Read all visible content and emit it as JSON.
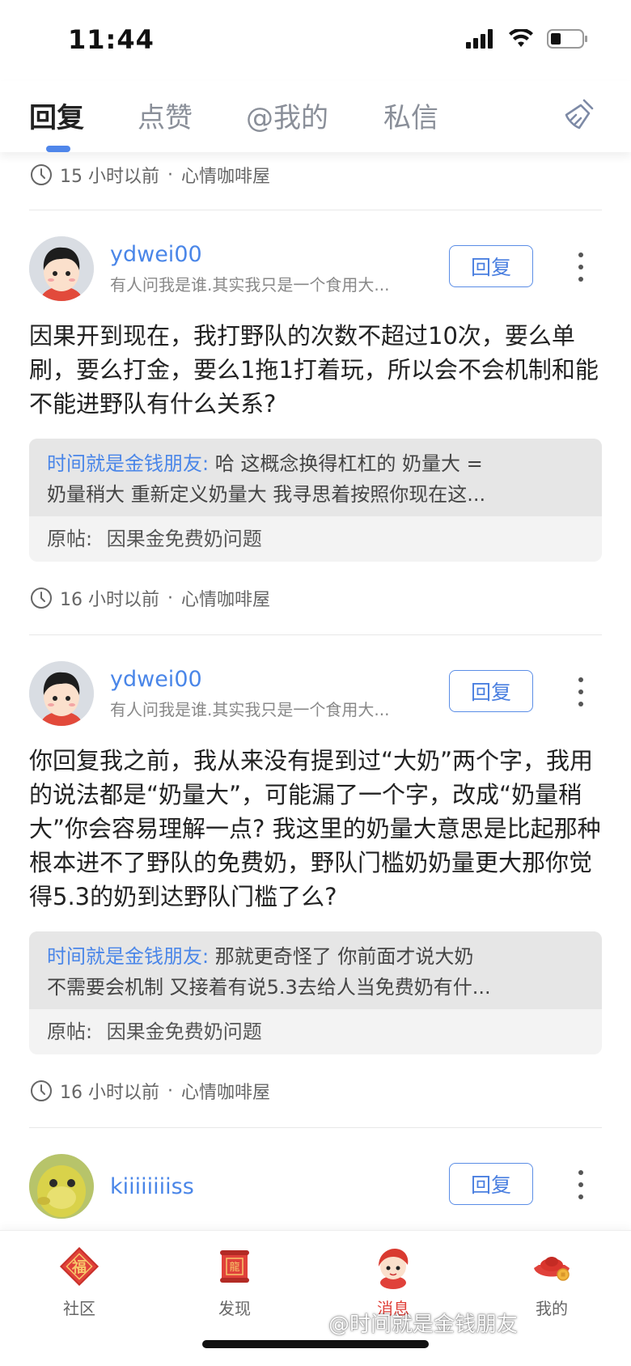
{
  "status_bar": {
    "time": "11:44"
  },
  "tabs": [
    {
      "label": "回复"
    },
    {
      "label": "点赞"
    },
    {
      "label": "@我的"
    },
    {
      "label": "私信"
    }
  ],
  "top_meta": {
    "time": "15 小时以前",
    "separator": "·",
    "forum": "心情咖啡屋"
  },
  "posts": [
    {
      "username": "ydwei00",
      "signature": "有人问我是谁.其实我只是一个食用大...",
      "reply_label": "回复",
      "body": "因果开到现在，我打野队的次数不超过10次，要么单刷，要么打金，要么1拖1打着玩，所以会不会机制和能不能进野队有什么关系?",
      "quote_name": "时间就是金钱朋友:",
      "quote_line1": " 哈 这概念换得杠杠的 奶量大 =",
      "quote_line2": "奶量稍大 重新定义奶量大 我寻思着按照你现在这...",
      "original_label": "原帖:",
      "original_title": "因果金免费奶问题",
      "time": "16 小时以前",
      "separator": "·",
      "forum": "心情咖啡屋"
    },
    {
      "username": "ydwei00",
      "signature": "有人问我是谁.其实我只是一个食用大...",
      "reply_label": "回复",
      "body": "你回复我之前，我从来没有提到过“大奶”两个字，我用的说法都是“奶量大”，可能漏了一个字，改成“奶量稍大”你会容易理解一点? 我这里的奶量大意思是比起那种根本进不了野队的免费奶，野队门槛奶奶量更大那你觉得5.3的奶到达野队门槛了么?",
      "quote_name": "时间就是金钱朋友:",
      "quote_line1": " 那就更奇怪了 你前面才说大奶",
      "quote_line2": "不需要会机制 又接着有说5.3去给人当免费奶有什...",
      "original_label": "原帖:",
      "original_title": "因果金免费奶问题",
      "time": "16 小时以前",
      "separator": "·",
      "forum": "心情咖啡屋"
    },
    {
      "username": "kiiiiiiiiss",
      "reply_label": "回复"
    }
  ],
  "bottom_nav": [
    {
      "label": "社区",
      "icon": "fu-icon"
    },
    {
      "label": "发现",
      "icon": "dragon-scroll-icon"
    },
    {
      "label": "消息",
      "icon": "message-character-icon",
      "active": true
    },
    {
      "label": "我的",
      "icon": "gold-ingot-icon"
    }
  ],
  "watermark": "@时间就是金钱朋友",
  "colors": {
    "accent": "#4a86e8",
    "active_nav": "#e0413a"
  }
}
